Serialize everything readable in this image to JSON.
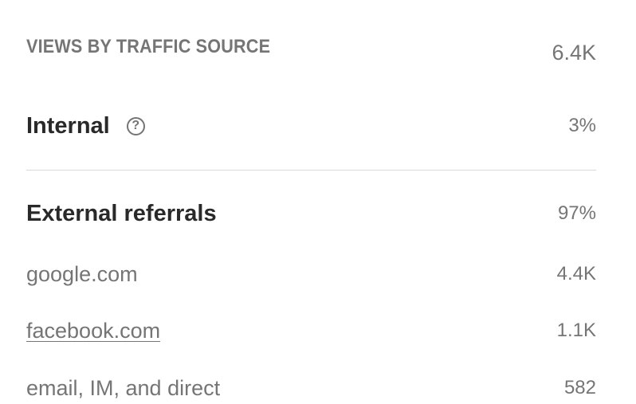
{
  "header": {
    "title": "VIEWS BY TRAFFIC SOURCE",
    "total": "6.4K"
  },
  "internal": {
    "label": "Internal",
    "help_icon": "help-circle-icon",
    "percent": "3%"
  },
  "external": {
    "label": "External referrals",
    "percent": "97%",
    "sources": [
      {
        "label": "google.com",
        "value": "4.4K",
        "link": false
      },
      {
        "label": "facebook.com",
        "value": "1.1K",
        "link": true
      },
      {
        "label": "email, IM, and direct",
        "value": "582",
        "link": false
      }
    ]
  },
  "colors": {
    "text_dark": "#292929",
    "text_muted": "#757575",
    "divider": "#d9d9d9",
    "background": "#ffffff"
  }
}
